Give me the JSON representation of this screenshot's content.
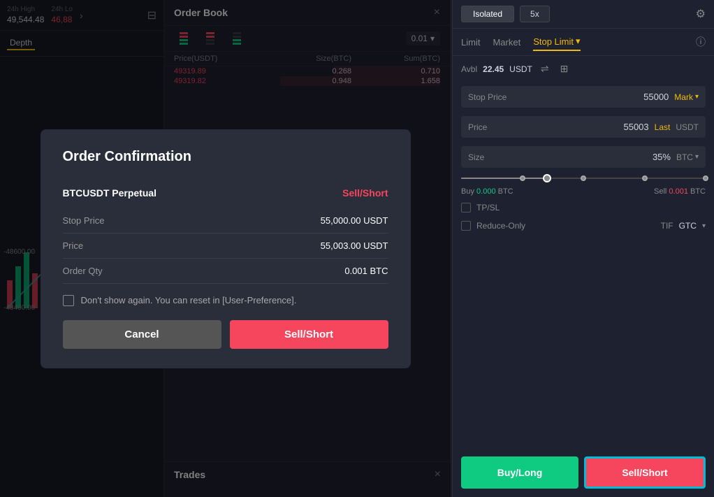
{
  "leftPanel": {
    "stats": [
      {
        "label": "24h High",
        "value": "49,544.48",
        "color": "normal"
      },
      {
        "label": "24h Lo",
        "value": "46,88",
        "color": "red"
      }
    ],
    "tab": "Depth",
    "prices": {
      "p1": "-48600.00",
      "p2": "-48400.00"
    }
  },
  "orderBook": {
    "title": "Order Book",
    "closeIcon": "×",
    "sizeValue": "0.01",
    "columns": [
      "Price(USDT)",
      "Size(BTC)",
      "Sum(BTC)"
    ],
    "sellRows": [
      {
        "price": "49319.89",
        "size": "0.268",
        "sum": "0.710"
      },
      {
        "price": "49319.82",
        "size": "0.948",
        "sum": "1.658"
      }
    ]
  },
  "trades": {
    "title": "Trades",
    "closeIcon": "×"
  },
  "rightPanel": {
    "marginMode": "Isolated",
    "leverage": "5x",
    "settingsIcon": "⚙",
    "tabs": [
      {
        "label": "Limit",
        "active": false
      },
      {
        "label": "Market",
        "active": false
      },
      {
        "label": "Stop Limit",
        "active": true
      }
    ],
    "tabDropdownCaret": "▾",
    "infoIcon": "ⓘ",
    "avbl": {
      "label": "Avbl",
      "value": "22.45",
      "unit": "USDT",
      "transferIcon": "⇌",
      "calcIcon": "⊞"
    },
    "stopPrice": {
      "label": "Stop Price",
      "value": "55000",
      "tag": "Mark",
      "caret": "▾"
    },
    "price": {
      "label": "Price",
      "value": "55003",
      "tag": "Last",
      "unit": "USDT"
    },
    "size": {
      "label": "Size",
      "value": "35%",
      "unit": "BTC",
      "caret": "▾"
    },
    "slider": {
      "percent": 35
    },
    "buyInfo": {
      "label": "Buy",
      "value": "0.000",
      "unit": "BTC"
    },
    "sellInfo": {
      "label": "Sell",
      "value": "0.001",
      "unit": "BTC"
    },
    "tpsl": {
      "label": "TP/SL"
    },
    "reduceOnly": {
      "label": "Reduce-Only"
    },
    "tif": {
      "label": "TIF",
      "value": "GTC",
      "caret": "▾"
    },
    "buyBtn": "Buy/Long",
    "sellBtn": "Sell/Short"
  },
  "modal": {
    "title": "Order Confirmation",
    "contract": "BTCUSDT Perpetual",
    "side": "Sell/Short",
    "rows": [
      {
        "label": "Stop Price",
        "value": "55,000.00 USDT"
      },
      {
        "label": "Price",
        "value": "55,003.00 USDT"
      },
      {
        "label": "Order Qty",
        "value": "0.001 BTC"
      }
    ],
    "checkboxText": "Don't show again. You can reset in [User-Preference].",
    "cancelBtn": "Cancel",
    "confirmBtn": "Sell/Short"
  }
}
